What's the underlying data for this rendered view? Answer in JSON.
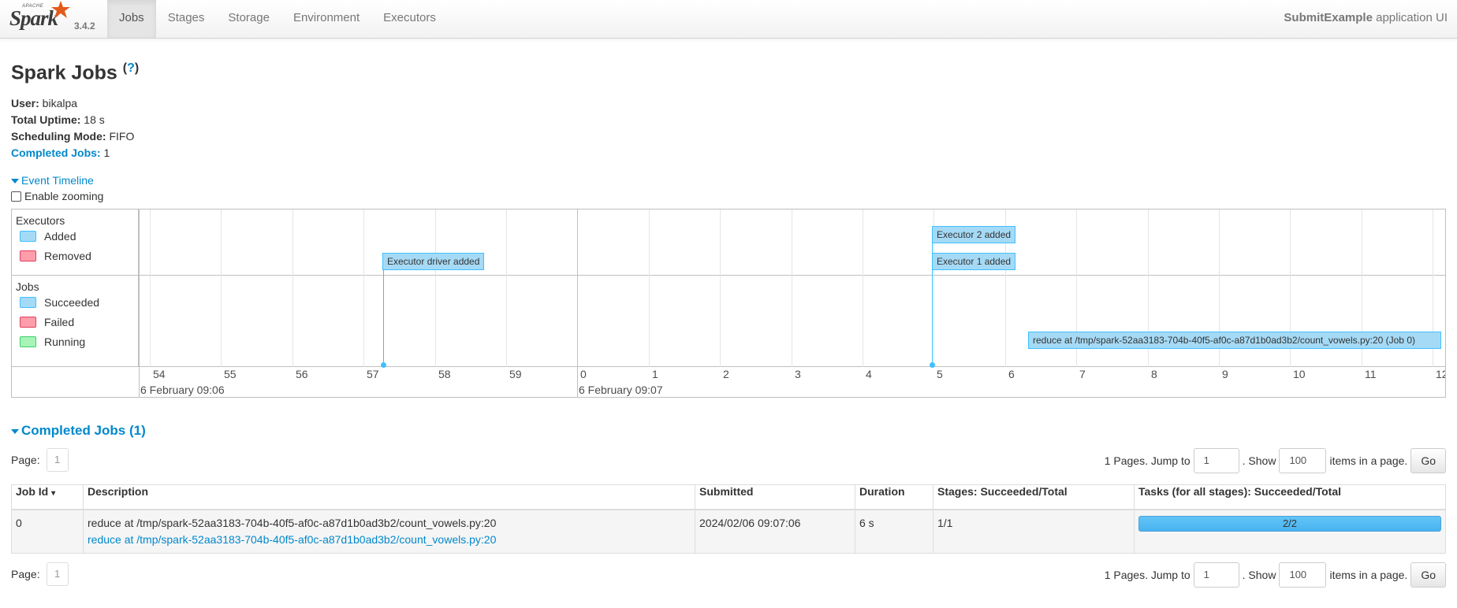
{
  "nav": {
    "brand_top": "APACHE",
    "brand_word": "Spark",
    "version": "3.4.2",
    "tabs": [
      {
        "label": "Jobs",
        "active": true
      },
      {
        "label": "Stages",
        "active": false
      },
      {
        "label": "Storage",
        "active": false
      },
      {
        "label": "Environment",
        "active": false
      },
      {
        "label": "Executors",
        "active": false
      }
    ],
    "app_name": "SubmitExample",
    "app_suffix": " application UI"
  },
  "header": {
    "title": "Spark Jobs",
    "help": "?",
    "user_label": "User:",
    "user_value": " bikalpa",
    "uptime_label": "Total Uptime:",
    "uptime_value": " 18 s",
    "mode_label": "Scheduling Mode:",
    "mode_value": " FIFO",
    "completed_label": "Completed Jobs:",
    "completed_value": " 1"
  },
  "timeline": {
    "toggle_label": "Event Timeline",
    "zoom_label": "Enable zooming",
    "executors_title": "Executors",
    "executor_legend": [
      "Added",
      "Removed"
    ],
    "jobs_title": "Jobs",
    "job_legend": [
      "Succeeded",
      "Failed",
      "Running"
    ],
    "ticks": [
      "54",
      "55",
      "56",
      "57",
      "58",
      "59",
      "0",
      "1",
      "2",
      "3",
      "4",
      "5",
      "6",
      "7",
      "8",
      "9",
      "10",
      "11",
      "12"
    ],
    "date_labels": [
      "6 February 09:06",
      "6 February 09:07"
    ],
    "events": {
      "driver": "Executor driver added",
      "exec2": "Executor 2 added",
      "exec1": "Executor 1 added",
      "job0": "reduce at /tmp/spark-52aa3183-704b-40f5-af0c-a87d1b0ad3b2/count_vowels.py:20 (Job 0)"
    },
    "colors": {
      "added": "#a5daf6",
      "removed": "#ff9eab",
      "running": "#a8f3b8"
    }
  },
  "completed": {
    "title": "Completed Jobs (1)",
    "pager": {
      "page_label": "Page:",
      "page_value": "1",
      "pages_text": "1 Pages. Jump to",
      "jump_value": "1",
      "show_text": ". Show",
      "show_value": "100",
      "items_text": "items in a page.",
      "go_label": "Go"
    },
    "columns": [
      "Job Id",
      "Description",
      "Submitted",
      "Duration",
      "Stages: Succeeded/Total",
      "Tasks (for all stages): Succeeded/Total"
    ],
    "sort_indicator": "▾",
    "rows": [
      {
        "job_id": "0",
        "desc_main": "reduce at /tmp/spark-52aa3183-704b-40f5-af0c-a87d1b0ad3b2/count_vowels.py:20",
        "desc_link": "reduce at /tmp/spark-52aa3183-704b-40f5-af0c-a87d1b0ad3b2/count_vowels.py:20",
        "submitted": "2024/02/06 09:07:06",
        "duration": "6 s",
        "stages": "1/1",
        "tasks": "2/2",
        "tasks_fraction": 1.0
      }
    ]
  }
}
